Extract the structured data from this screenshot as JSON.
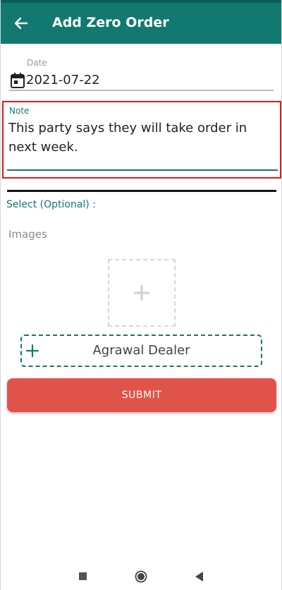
{
  "app_bar": {
    "title": "Add Zero Order",
    "back_icon": "arrow-left-icon",
    "color": "#11796f"
  },
  "date_field": {
    "label": "Date",
    "value": "2021-07-22",
    "icon": "calendar-icon"
  },
  "note_field": {
    "label": "Note",
    "value": "This party says they will take order in next week."
  },
  "select_section": {
    "label": "Select (Optional) :"
  },
  "images_section": {
    "label": "Images",
    "add_icon": "plus-icon"
  },
  "dealer_selector": {
    "value": "Agrawal Dealer",
    "icon": "plus-icon"
  },
  "submit_button": {
    "label": "SUBMIT",
    "color": "#e0534a"
  },
  "nav_bar": {
    "icons": [
      "recents-icon",
      "home-icon",
      "back-icon"
    ]
  }
}
